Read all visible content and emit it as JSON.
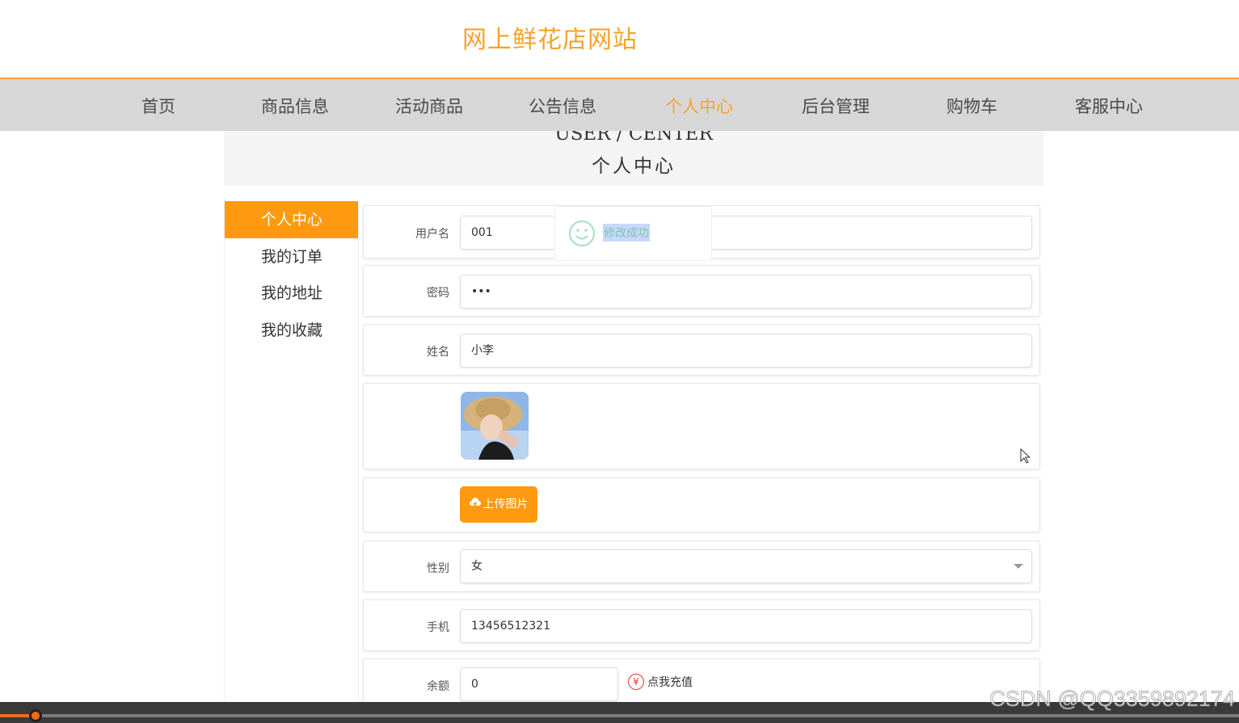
{
  "site": {
    "title": "网上鲜花店网站"
  },
  "nav": {
    "items": [
      {
        "label": "首页"
      },
      {
        "label": "商品信息"
      },
      {
        "label": "活动商品"
      },
      {
        "label": "公告信息"
      },
      {
        "label": "个人中心"
      },
      {
        "label": "后台管理"
      },
      {
        "label": "购物车"
      },
      {
        "label": "客服中心"
      }
    ],
    "active": "个人中心"
  },
  "banner": {
    "en": "USER / CENTER",
    "cn": "个人中心"
  },
  "sidebar": {
    "items": [
      {
        "label": "个人中心"
      },
      {
        "label": "我的订单"
      },
      {
        "label": "我的地址"
      },
      {
        "label": "我的收藏"
      }
    ]
  },
  "form": {
    "username": {
      "label": "用户名",
      "value": "001"
    },
    "password": {
      "label": "密码",
      "value": "•••"
    },
    "name": {
      "label": "姓名",
      "value": "小李"
    },
    "upload": {
      "label": "上传图片"
    },
    "gender": {
      "label": "性别",
      "value": "女"
    },
    "phone": {
      "label": "手机",
      "value": "13456512321"
    },
    "balance": {
      "label": "余额",
      "value": "0",
      "recharge": "点我充值",
      "currency": "¥"
    }
  },
  "toast": {
    "message": "修改成功"
  },
  "watermark": "CSDN @QQ3359892174",
  "colors": {
    "accent": "#ff9a10",
    "title": "#f7a22a",
    "nav_bg": "#d7d7d7"
  }
}
